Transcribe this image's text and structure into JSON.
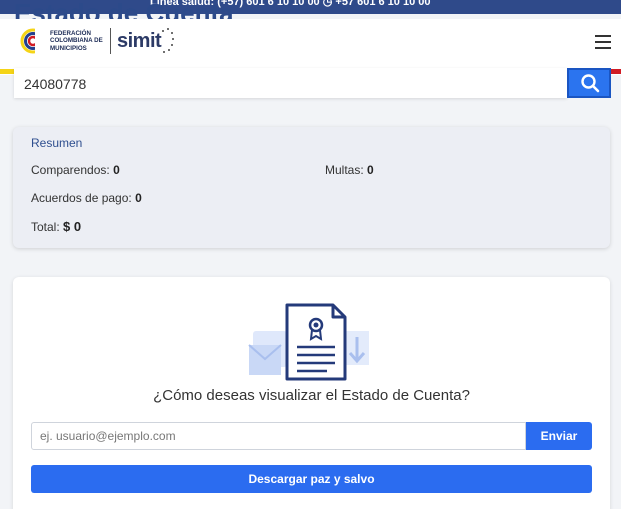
{
  "topbar": {
    "info": "Línea salud: (+57) 601 6 10 10 00   ◷ +57 601 6 10 10 00"
  },
  "page": {
    "title": "Estado de Cuenta"
  },
  "header": {
    "logo_org": "FEDERACIÓN COLOMBIANA DE MUNICIPIOS",
    "logo_brand": "simit",
    "menu_icon": "hamburger-icon",
    "flag_colors": [
      "#f5d417",
      "#23408e",
      "#d11c24"
    ]
  },
  "search": {
    "value": "24080778",
    "button_icon": "search-icon",
    "accent": "#2b74ef"
  },
  "summary": {
    "heading": "Resumen",
    "comparendos_label": "Comparendos:",
    "comparendos_value": "0",
    "multas_label": "Multas:",
    "multas_value": "0",
    "acuerdos_label": "Acuerdos de pago:",
    "acuerdos_value": "0",
    "total_label": "Total:",
    "total_value": "$ 0"
  },
  "account": {
    "illustration_icon": "certificate-document-icon",
    "question": "¿Cómo deseas visualizar el Estado de Cuenta?",
    "email_placeholder": "ej. usuario@ejemplo.com",
    "send_label": "Enviar",
    "download_label": "Descargar paz y salvo",
    "button_color": "#2b6cf0"
  }
}
